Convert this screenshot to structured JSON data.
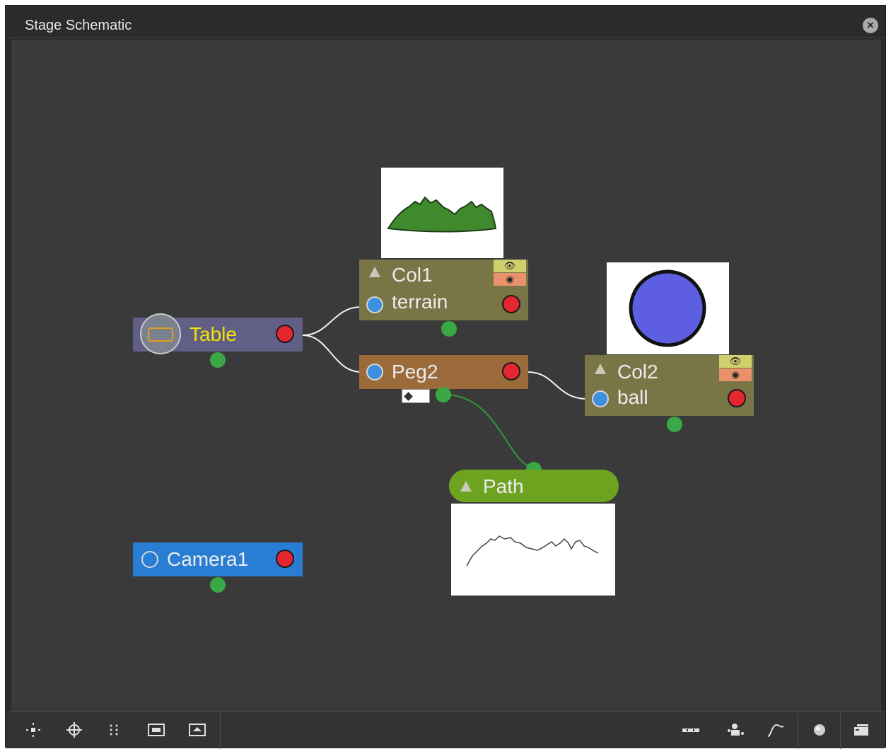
{
  "window": {
    "title": "Stage Schematic",
    "close_icon": "close-circle-icon"
  },
  "nodes": {
    "table": {
      "label": "Table",
      "color": "#625f86",
      "label_color": "#f2e400"
    },
    "col1": {
      "name": "Col1",
      "level": "terrain",
      "color": "#7a7546"
    },
    "peg2": {
      "label": "Peg2",
      "color": "#9c6b3c"
    },
    "col2": {
      "name": "Col2",
      "level": "ball",
      "color": "#7a7546"
    },
    "path": {
      "label": "Path",
      "color": "#6ea320"
    },
    "camera1": {
      "label": "Camera1",
      "color": "#2a7dd4"
    }
  },
  "toggles": {
    "camstand": "eye-icon",
    "preview": "camstand-icon"
  },
  "toolbar": {
    "left": [
      "fit-to-window-icon",
      "focus-on-current-icon",
      "reorder-nodes-icon",
      "normal-size-icon",
      "maximize-nodes-icon"
    ],
    "right": [
      "minimize-nodes-icon",
      "new-pegbar-icon",
      "new-motion-path-icon",
      "toggle-preview-icon",
      "swap-fx-stage-icon"
    ]
  }
}
